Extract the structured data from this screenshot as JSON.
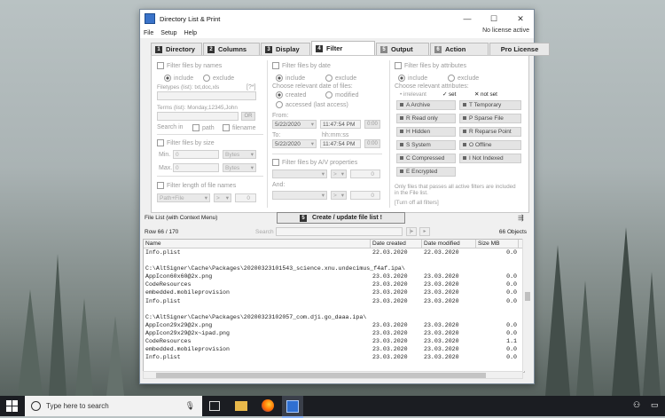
{
  "window": {
    "title": "Directory List & Print",
    "license": "No license active"
  },
  "menu": [
    "File",
    "Setup",
    "Help"
  ],
  "tabs": [
    {
      "num": "1",
      "label": "Directory"
    },
    {
      "num": "2",
      "label": "Columns"
    },
    {
      "num": "3",
      "label": "Display"
    },
    {
      "num": "4",
      "label": "Filter"
    },
    {
      "num": "5",
      "label": "Output"
    },
    {
      "num": "6",
      "label": "Action"
    },
    {
      "num": "",
      "label": "Pro License"
    }
  ],
  "filter": {
    "names": {
      "title": "Filter files by names",
      "include": "include",
      "exclude": "exclude",
      "filetypes_label": "Filetypes (list): txt,doc,xls",
      "wildcard": "[?*]",
      "terms_label": "Terms (list): Monday,12345,John",
      "or": "OR",
      "search_in": "Search in",
      "path": "path",
      "filename": "filename"
    },
    "size": {
      "title": "Filter files by size",
      "min": "Min.",
      "max": "Max.",
      "min_val": "0",
      "max_val": "0",
      "unit": "Bytes"
    },
    "length": {
      "title": "Filter length of file names",
      "mode": "Path+File",
      "op": ">",
      "val": "0"
    },
    "date": {
      "title": "Filter files by date",
      "include": "include",
      "exclude": "exclude",
      "choose": "Choose relevant date of files:",
      "created": "created",
      "modified": "modified",
      "accessed": "accessed (last access)",
      "from": "From:",
      "to": "To:",
      "hms": "hh:mm:ss",
      "date1": "5/22/2020",
      "time1": "11:47:54 PM",
      "date2": "5/22/2020",
      "time2": "11:47:54 PM",
      "zero": "0:00"
    },
    "av": {
      "title": "Filter files by A/V properties",
      "op": ">",
      "val": "0",
      "and": "And:"
    },
    "attributes": {
      "title": "Filter files by attributes",
      "include": "include",
      "exclude": "exclude",
      "choose": "Choose relevant attributes:",
      "irrelevant": "irrelevant",
      "set": "set",
      "notset": "not set",
      "left": [
        "A Archive",
        "R Read only",
        "H Hidden",
        "S System",
        "C Compressed",
        "E Encrypted"
      ],
      "right": [
        "T Temporary",
        "P Sparse File",
        "R Reparse Point",
        "O Offline",
        "I Not Indexed"
      ],
      "note": "Only files that passes all active filters are included in the File list.",
      "turnoff": "[Turn off all filters]"
    }
  },
  "filelist": {
    "label": "File List (with Context Menu)",
    "create_num": "5",
    "create": "Create / update file list !",
    "row": "Row 66 / 170",
    "search": "Search",
    "objects": "66 Objects",
    "headers": [
      "Name",
      "Date created",
      "Date modified",
      "Size MB"
    ],
    "rows": [
      [
        "Info.plist",
        "22.03.2020",
        "22.03.2020",
        "0.0"
      ],
      [
        "",
        "",
        "",
        ""
      ],
      [
        "C:\\AltSigner\\Cache\\Packages\\20200323101543_science.xnu.undecimus_f4af.ipa\\",
        "",
        "",
        ""
      ],
      [
        "AppIcon60x60@2x.png",
        "23.03.2020",
        "23.03.2020",
        "0.0"
      ],
      [
        "CodeResources",
        "23.03.2020",
        "23.03.2020",
        "0.0"
      ],
      [
        "embedded.mobileprovision",
        "23.03.2020",
        "23.03.2020",
        "0.0"
      ],
      [
        "Info.plist",
        "23.03.2020",
        "23.03.2020",
        "0.0"
      ],
      [
        "",
        "",
        "",
        ""
      ],
      [
        "C:\\AltSigner\\Cache\\Packages\\20200323102057_com.dji.go_daaa.ipa\\",
        "",
        "",
        ""
      ],
      [
        "AppIcon29x29@2x.png",
        "23.03.2020",
        "23.03.2020",
        "0.0"
      ],
      [
        "AppIcon29x29@2x~ipad.png",
        "23.03.2020",
        "23.03.2020",
        "0.0"
      ],
      [
        "CodeResources",
        "23.03.2020",
        "23.03.2020",
        "1.1"
      ],
      [
        "embedded.mobileprovision",
        "23.03.2020",
        "23.03.2020",
        "0.0"
      ],
      [
        "Info.plist",
        "23.03.2020",
        "23.03.2020",
        "0.0"
      ]
    ]
  },
  "taskbar": {
    "search_placeholder": "Type here to search"
  }
}
